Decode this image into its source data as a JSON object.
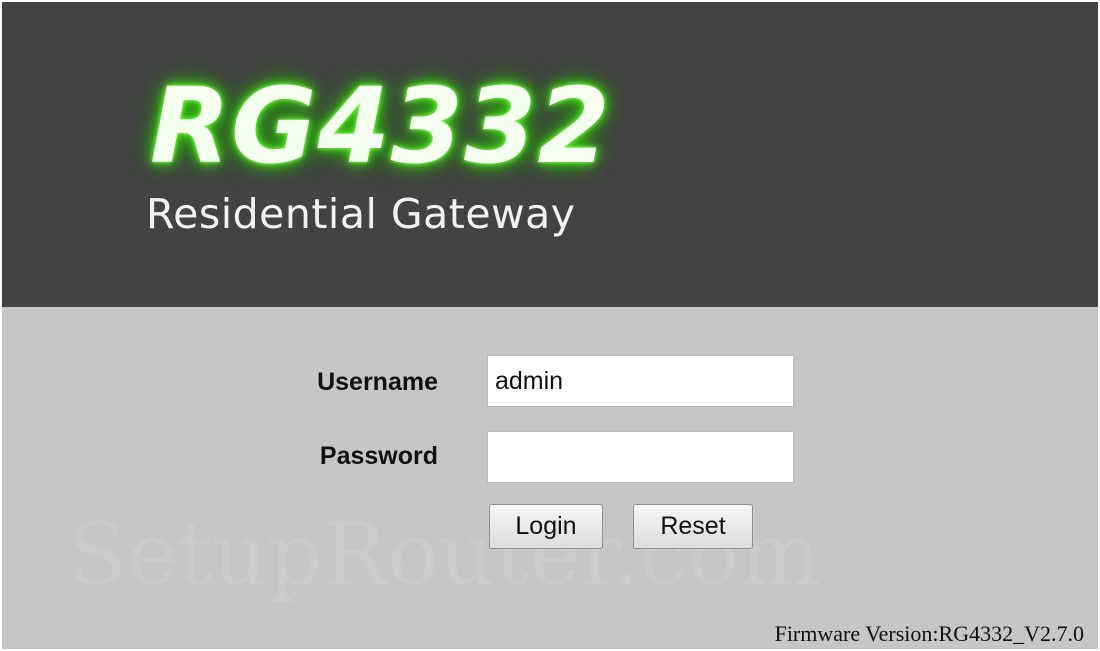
{
  "header": {
    "model": "RG4332",
    "subtitle": "Residential Gateway",
    "background_color": "#434343",
    "glow_color": "#4ee41c"
  },
  "login_form": {
    "username_label": "Username",
    "username_value": "admin",
    "password_label": "Password",
    "password_value": "",
    "login_button": "Login",
    "reset_button": "Reset",
    "background_color": "#c6c6c6"
  },
  "watermark": "SetupRouter.com",
  "footer": {
    "firmware_version": "Firmware Version:RG4332_V2.7.0"
  }
}
